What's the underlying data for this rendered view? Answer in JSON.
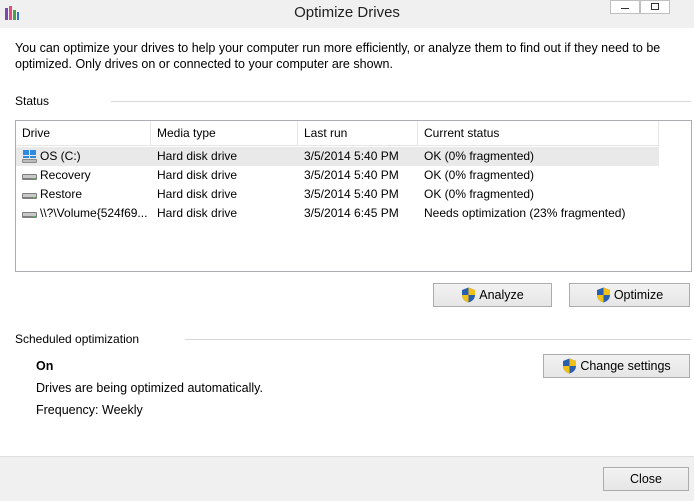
{
  "window": {
    "title": "Optimize Drives"
  },
  "intro": {
    "text": "You can optimize your drives to help your computer run more efficiently, or analyze them to find out if they need to be optimized. Only drives on or connected to your computer are shown."
  },
  "status_section": {
    "label": "Status",
    "columns": [
      "Drive",
      "Media type",
      "Last run",
      "Current status"
    ],
    "rows": [
      {
        "drive": "OS (C:)",
        "media": "Hard disk drive",
        "last_run": "3/5/2014 5:40 PM",
        "status": "OK (0% fragmented)",
        "icon": "windows-drive-icon",
        "selected": true
      },
      {
        "drive": "Recovery",
        "media": "Hard disk drive",
        "last_run": "3/5/2014 5:40 PM",
        "status": "OK (0% fragmented)",
        "icon": "drive-icon",
        "selected": false
      },
      {
        "drive": "Restore",
        "media": "Hard disk drive",
        "last_run": "3/5/2014 5:40 PM",
        "status": "OK (0% fragmented)",
        "icon": "drive-icon",
        "selected": false
      },
      {
        "drive": "\\\\?\\Volume{524f69...",
        "media": "Hard disk drive",
        "last_run": "3/5/2014 6:45 PM",
        "status": "Needs optimization (23% fragmented)",
        "icon": "drive-icon",
        "selected": false
      }
    ],
    "analyze_label": "Analyze",
    "optimize_label": "Optimize"
  },
  "schedule_section": {
    "label": "Scheduled optimization",
    "state": "On",
    "description": "Drives are being optimized automatically.",
    "frequency": "Frequency: Weekly",
    "change_label": "Change settings"
  },
  "footer": {
    "close_label": "Close"
  },
  "colors": {
    "selected_row": "#e9e9e9",
    "chrome": "#f0f0f0",
    "shield_blue": "#2a5fb0",
    "shield_yellow": "#f2c118"
  }
}
